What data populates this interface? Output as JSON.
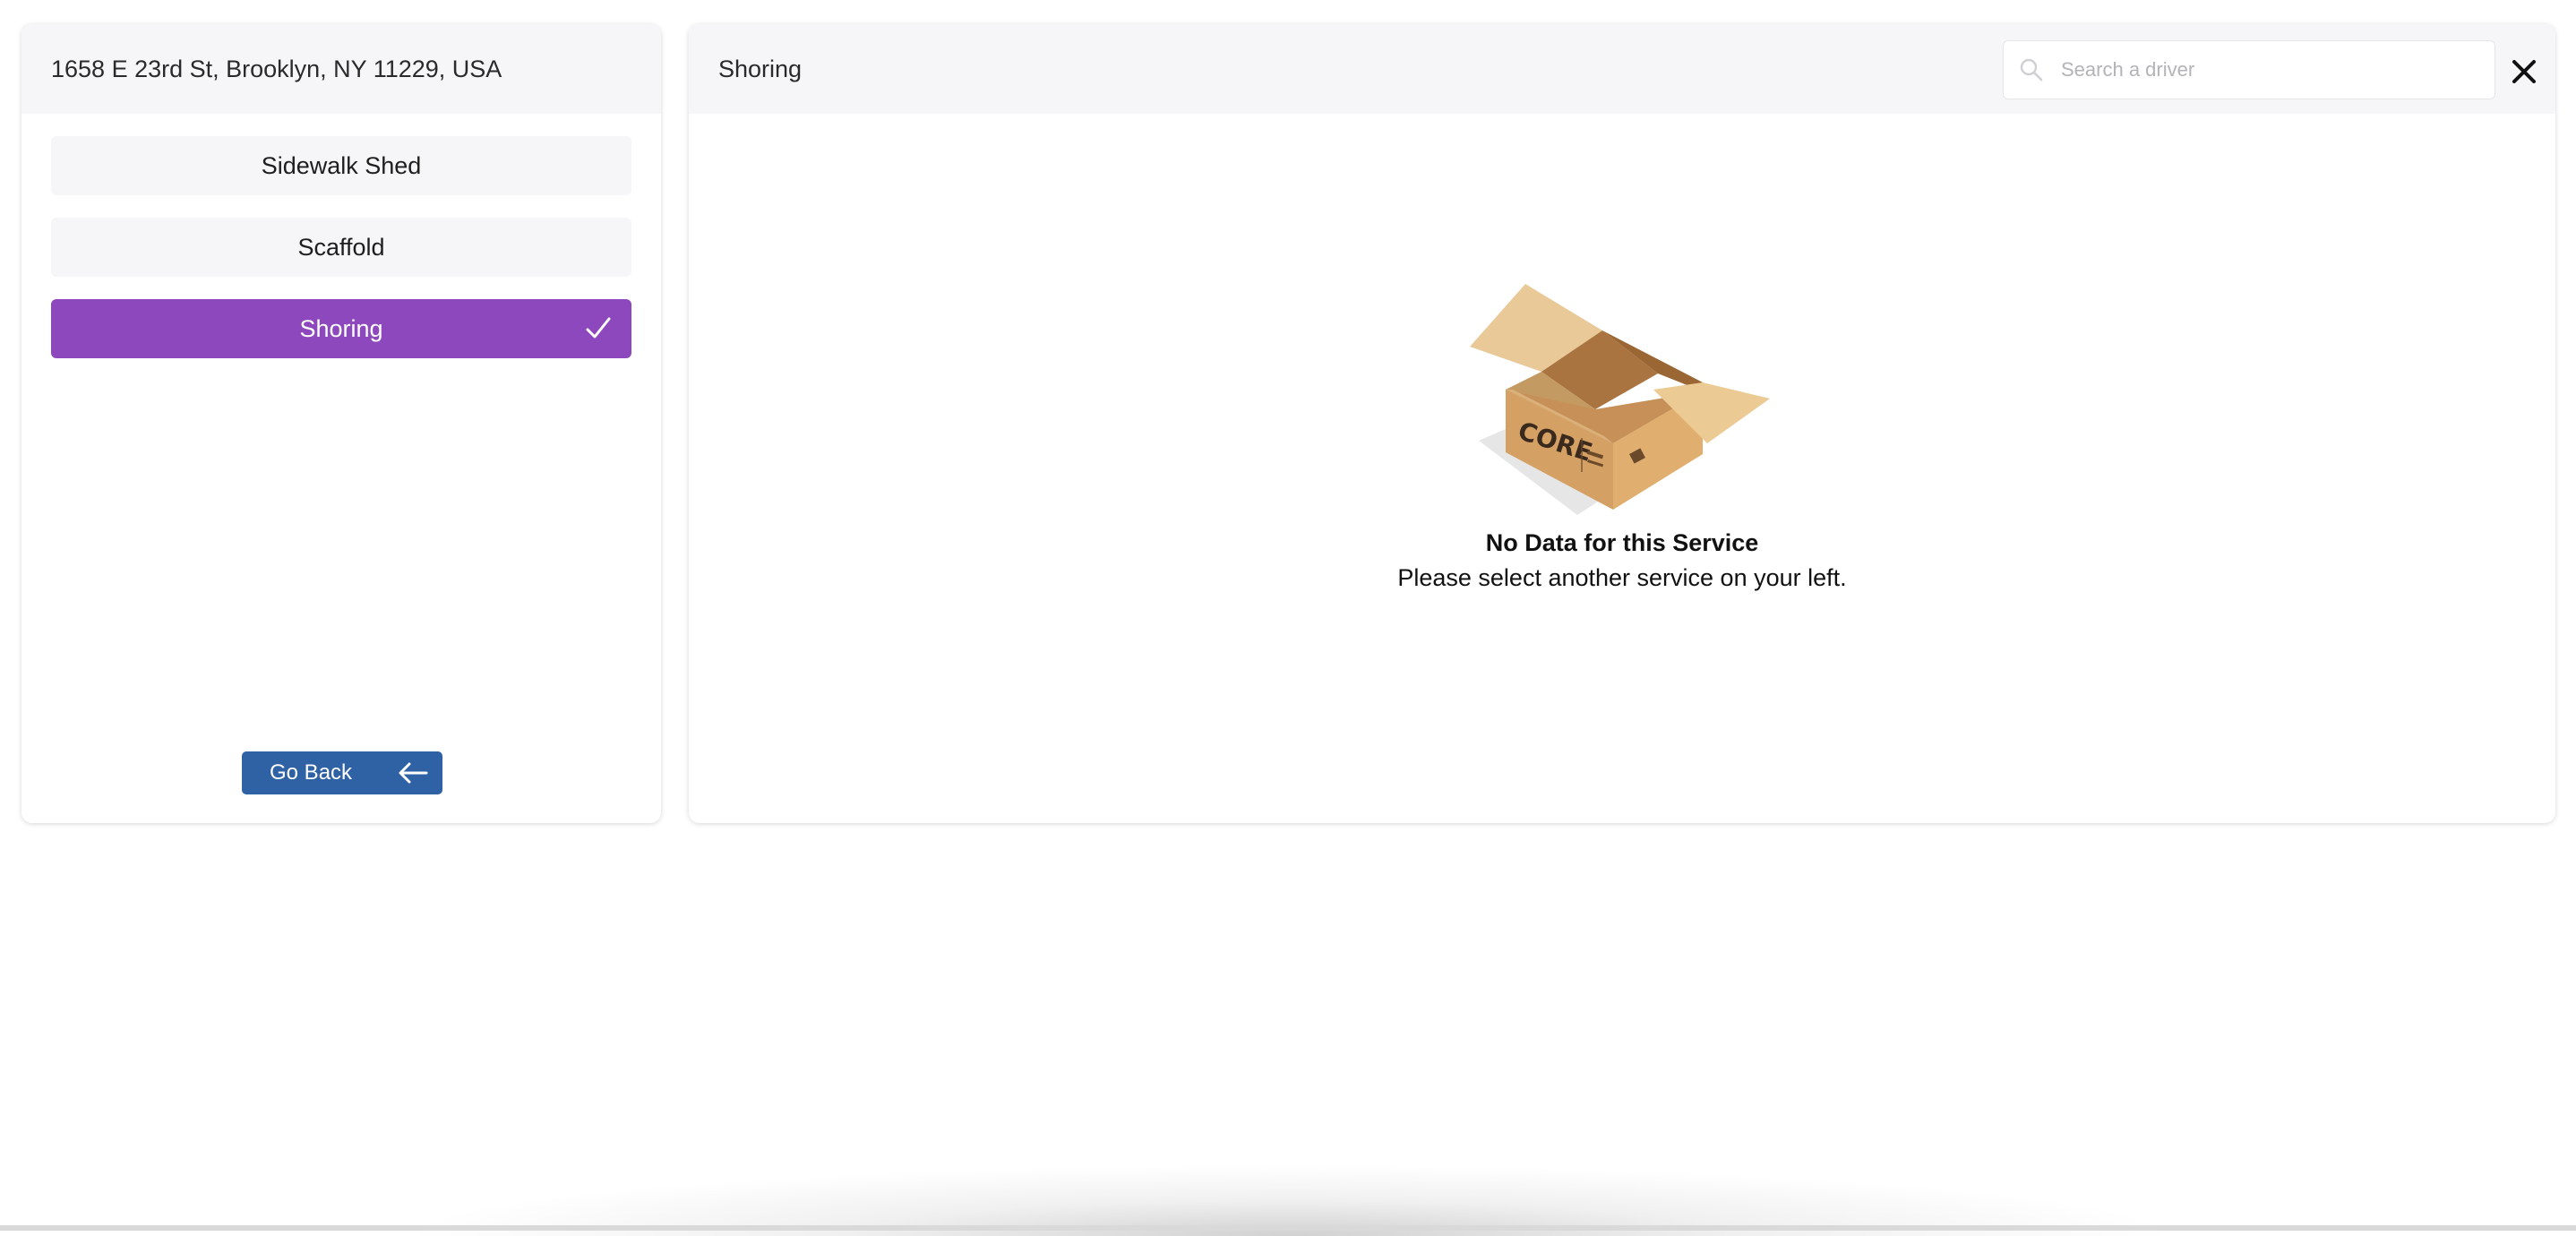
{
  "location": {
    "address": "1658 E 23rd St, Brooklyn, NY 11229, USA"
  },
  "services": [
    {
      "label": "Sidewalk Shed",
      "active": false
    },
    {
      "label": "Scaffold",
      "active": false
    },
    {
      "label": "Shoring",
      "active": true
    }
  ],
  "go_back_label": "Go Back",
  "detail": {
    "title": "Shoring",
    "search_placeholder": "Search a driver",
    "empty_title": "No Data for this Service",
    "empty_subtitle": "Please select another service on your left.",
    "box_logo_text": "CORE"
  },
  "colors": {
    "active_service": "#8e48bd",
    "go_back_button": "#2f62a4",
    "panel_header": "#f6f6f8"
  },
  "icons": {
    "active_check": "check-icon",
    "go_back": "arrow-left-icon",
    "search": "search-icon",
    "close": "close-icon",
    "empty": "empty-box-illustration"
  }
}
